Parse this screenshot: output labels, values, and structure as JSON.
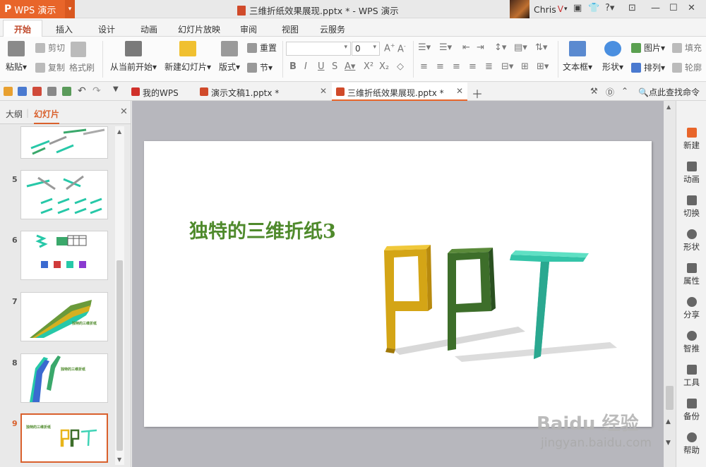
{
  "titlebar": {
    "app_label": "WPS 演示",
    "doc_title": "三维折纸效果展现.pptx * - WPS 演示",
    "user_name": "Chris"
  },
  "ribbon_tabs": [
    "开始",
    "插入",
    "设计",
    "动画",
    "幻灯片放映",
    "审阅",
    "视图",
    "云服务"
  ],
  "ribbon": {
    "paste": "粘贴",
    "cut": "剪切",
    "copy": "复制",
    "format_painter": "格式刷",
    "from_current": "从当前开始",
    "new_slide": "新建幻灯片",
    "layout": "版式",
    "reset": "重置",
    "section": "节",
    "font_size": "0",
    "textbox": "文本框",
    "shapes": "形状",
    "picture": "图片",
    "arrange": "排列",
    "fill": "填充",
    "outline": "轮廓"
  },
  "docbar": {
    "tabs": [
      {
        "label": "我的WPS",
        "active": false
      },
      {
        "label": "演示文稿1.pptx *",
        "active": false
      },
      {
        "label": "三维折纸效果展现.pptx *",
        "active": true
      }
    ],
    "search_label": "点此查找命令"
  },
  "leftpanel": {
    "outline_tab": "大纲",
    "slides_tab": "幻灯片",
    "slide_numbers": [
      "5",
      "6",
      "7",
      "8",
      "9"
    ],
    "thumb_text_7": "独特的三维折纸",
    "thumb_text_8": "独特的三维折纸",
    "thumb_text_9": "独特的三维折纸"
  },
  "slide": {
    "title": "独特的三维折纸3",
    "art_text": "PPT",
    "colors": {
      "p1": "#e8b51a",
      "p2": "#3d6e2a",
      "t": "#3fd3b6"
    }
  },
  "rightbar": [
    "新建",
    "动画",
    "切换",
    "形状",
    "属性",
    "分享",
    "智推",
    "工具",
    "备份",
    "帮助"
  ],
  "watermark": {
    "line1": "Baidu 经验",
    "line2": "jingyan.baidu.com"
  }
}
